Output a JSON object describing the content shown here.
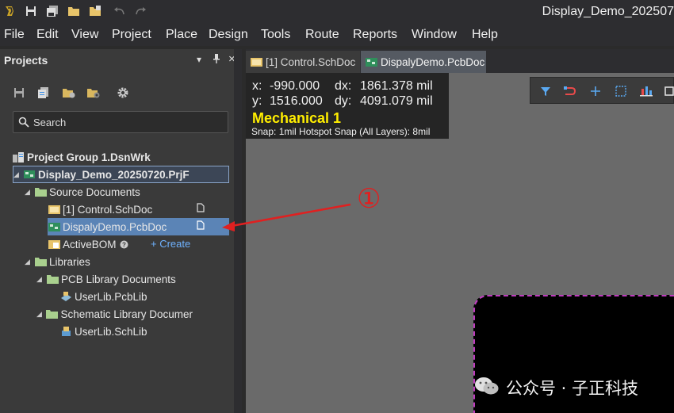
{
  "window": {
    "title": "Display_Demo_202507"
  },
  "titlebar_icons": [
    "app-logo-icon",
    "save-icon",
    "save-all-icon",
    "open-folder-icon",
    "open-project-icon",
    "undo-icon",
    "redo-icon"
  ],
  "menu": {
    "items": [
      "File",
      "Edit",
      "View",
      "Project",
      "Place",
      "Design",
      "Tools",
      "Route",
      "Reports",
      "Window",
      "Help"
    ]
  },
  "panel": {
    "title": "Projects",
    "dropdown_glyph": "▾",
    "pin_glyph": "⊥",
    "close_glyph": "×",
    "search_placeholder": "Search"
  },
  "tree": {
    "group": "Project Group 1.DsnWrk",
    "project": "Display_Demo_20250720.PrjF",
    "source_folder": "Source Documents",
    "docs": [
      "[1] Control.SchDoc",
      "DispalyDemo.PcbDoc",
      "ActiveBOM"
    ],
    "create_label": "+ Create",
    "libraries_folder": "Libraries",
    "pcb_lib_folder": "PCB Library Documents",
    "pcb_lib": "UserLib.PcbLib",
    "sch_lib_folder": "Schematic Library Documer",
    "sch_lib": "UserLib.SchLib"
  },
  "tabs": [
    "[1] Control.SchDoc",
    "DispalyDemo.PcbDoc"
  ],
  "coords": {
    "x_label": "x:",
    "x_value": "-990.000",
    "dx_label": "dx:",
    "dx_value": "1861.378 mil",
    "y_label": "y:",
    "y_value": "1516.000",
    "dy_label": "dy:",
    "dy_value": "4091.079 mil",
    "layer": "Mechanical 1",
    "snap": "Snap: 1mil Hotspot Snap (All Layers): 8mil"
  },
  "annotation": {
    "marker": "①",
    "color": "#e02020"
  },
  "watermark": {
    "text": "公众号 · 子正科技"
  },
  "colors": {
    "layer_yellow": "#ffee00",
    "selection_blue": "#5b84b6",
    "board_outline": "#c03cc0",
    "canvas_gray": "#6a6a6a"
  }
}
